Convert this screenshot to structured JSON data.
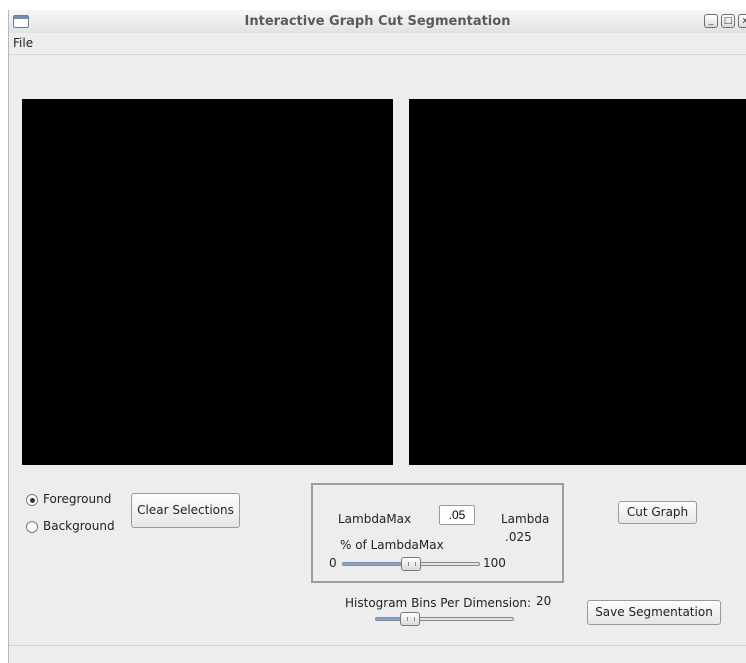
{
  "window": {
    "title": "Interactive Graph Cut Segmentation",
    "minimize_glyph": "_",
    "maximize_glyph": "□",
    "close_glyph": "x"
  },
  "menu": {
    "items": [
      {
        "label": "File"
      }
    ]
  },
  "selection_mode": {
    "options": [
      {
        "label": "Foreground",
        "checked": true
      },
      {
        "label": "Background",
        "checked": false
      }
    ]
  },
  "buttons": {
    "clear_selections": "Clear Selections",
    "cut_graph": "Cut Graph",
    "save_segmentation": "Save Segmentation"
  },
  "lambda_panel": {
    "lambda_max_label": "LambdaMax",
    "lambda_max_value": ".05",
    "lambda_label": "Lambda",
    "lambda_value": ".025",
    "percent_label": "% of LambdaMax",
    "slider_min": "0",
    "slider_max": "100",
    "slider_value_percent": 50
  },
  "histogram": {
    "label": "Histogram Bins Per Dimension:",
    "value": "20",
    "slider_value_fraction": 0.25
  },
  "colors": {
    "canvas": "#000000",
    "slider_fill": "#7ea6d6",
    "window_bg": "#ededed"
  },
  "icons": {
    "app": "window-app-icon",
    "minimize": "minimize-icon",
    "maximize": "maximize-icon",
    "close": "close-icon"
  }
}
